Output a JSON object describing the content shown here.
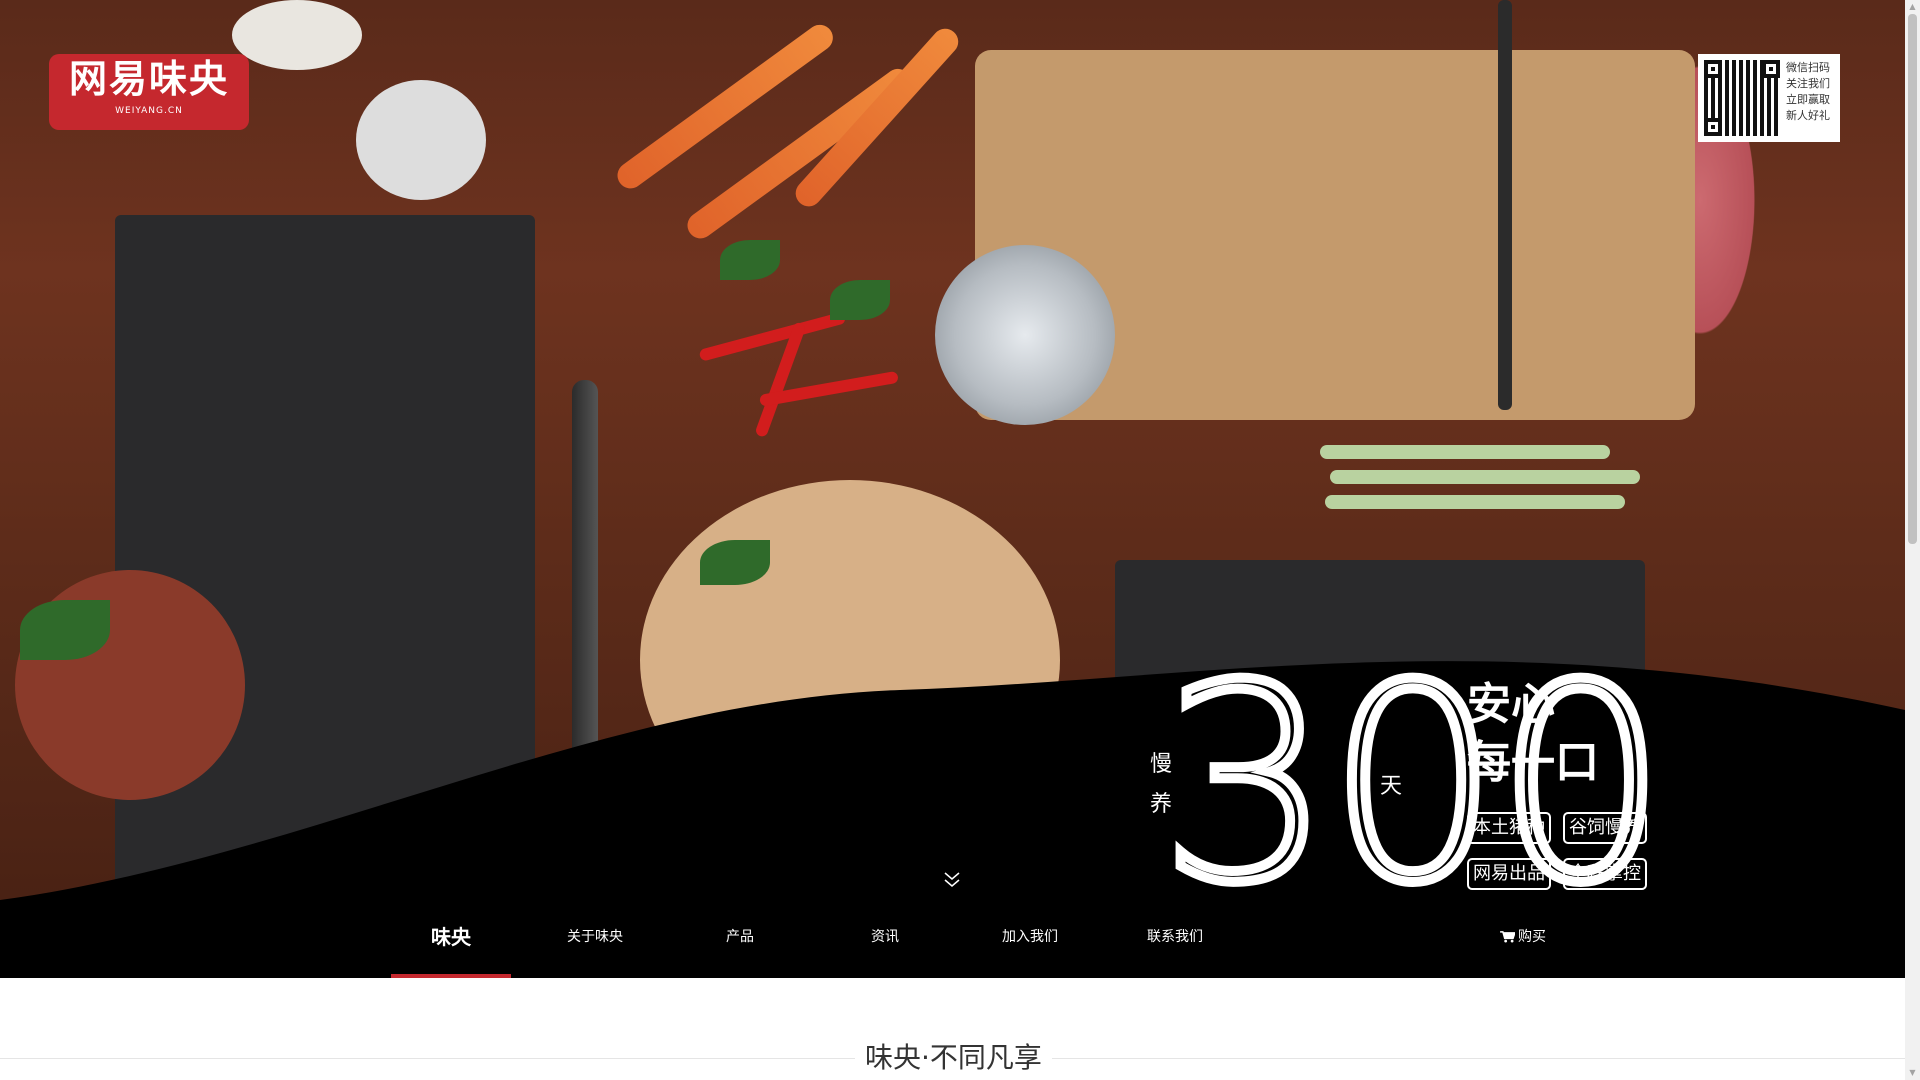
{
  "brand": {
    "name_cn": "网易味央",
    "name_en": "WEIYANG.CN"
  },
  "qr": {
    "lines": [
      "微信扫码",
      "关注我们",
      "立即赢取",
      "新人好礼"
    ]
  },
  "hero": {
    "side_left": [
      "慢",
      "养"
    ],
    "number": "300",
    "unit": "天",
    "slogan_line1": "安心",
    "slogan_line2": "每一口",
    "tags": [
      "本土猪种",
      "谷饲慢养",
      "网易出品",
      "全程掌控"
    ]
  },
  "nav": {
    "items": [
      {
        "label": "味央",
        "active": true
      },
      {
        "label": "关于味央",
        "active": false
      },
      {
        "label": "产品",
        "active": false
      },
      {
        "label": "资讯",
        "active": false
      },
      {
        "label": "加入我们",
        "active": false
      },
      {
        "label": "联系我们",
        "active": false
      }
    ],
    "buy_label": "购买"
  },
  "section": {
    "title": "味央·不同凡享"
  },
  "colors": {
    "brand_red": "#c5282e",
    "nav_bg": "#000000"
  }
}
